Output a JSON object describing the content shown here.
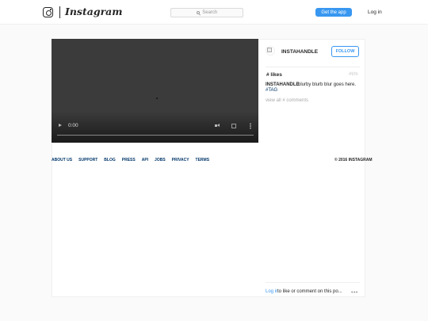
{
  "header": {
    "brand": "Instagram",
    "search_placeholder": "Search",
    "get_app_label": "Get the app",
    "login_label": "Log in"
  },
  "video": {
    "time": "0:00"
  },
  "post": {
    "username": "INSTAHANDLE",
    "follow_label": "FOLLOW",
    "likes": "# likes",
    "timestamp": "#t/m",
    "caption_user": "INSTAHANDLE",
    "caption_text": "blurby blurb blur goes here.",
    "tag": "#TAG",
    "view_comments": "view all # comments",
    "login_link": "Log in",
    "login_prompt": "to like or comment on this po...",
    "more_label": "•••"
  },
  "footer": {
    "links": [
      "ABOUT US",
      "SUPPORT",
      "BLOG",
      "PRESS",
      "API",
      "JOBS",
      "PRIVACY",
      "TERMS"
    ],
    "copyright": "© 2016 INSTAGRAM"
  }
}
